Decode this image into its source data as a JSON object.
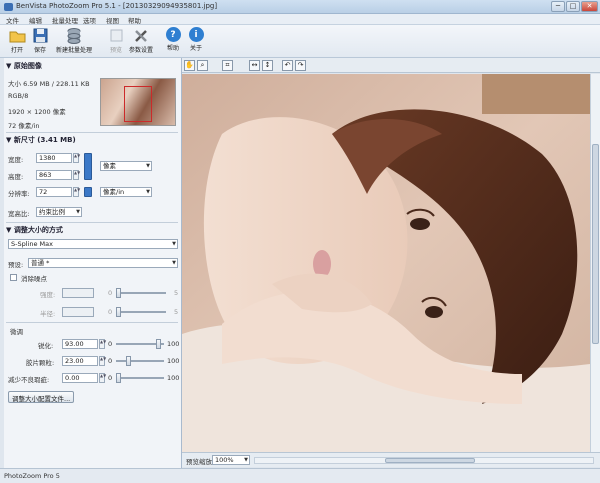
{
  "window": {
    "title": "BenVista PhotoZoom Pro 5.1 - [20130329094935801.jpg]",
    "min_label": "─",
    "max_label": "□",
    "close_label": "✕"
  },
  "menu": [
    "文件",
    "编辑",
    "批量处理",
    "选项",
    "视图",
    "帮助"
  ],
  "toolbar": {
    "open": "打开",
    "save": "保存",
    "batch": "新建批量处理",
    "preview": "预览",
    "settings": "参数设置",
    "help": "帮助",
    "about": "关于"
  },
  "original_image": {
    "header": "▼ 原始图像",
    "size_line": "大小 6.59 MB / 228.11 KB",
    "color_mode": "RGB/8",
    "dimensions": "1920 × 1200 像素",
    "resolution": "72 像素/in"
  },
  "new_size": {
    "header": "▼ 新尺寸 (3.41 MB)",
    "width_label": "宽度:",
    "width_value": "1380",
    "height_label": "高度:",
    "height_value": "863",
    "resolution_label": "分辨率:",
    "resolution_value": "72",
    "unit_select": "像素",
    "res_unit_select": "像素/in",
    "aspect_label": "宽高比:",
    "aspect_value": "约束比例"
  },
  "resize_method": {
    "header": "▼ 调整大小的方式",
    "method_value": "S-Spline Max",
    "preset_label": "预设:",
    "preset_value": "普通 *"
  },
  "noise": {
    "checkbox_label": "消除噪点",
    "strength_label": "强度:",
    "radius_label": "半径:",
    "slider_min": "0",
    "slider_max": "5"
  },
  "tuning": {
    "header": "微调",
    "sharpen_label": "锐化:",
    "sharpen_value": "93.00",
    "sharpen_level": 0.93,
    "film_grain_label": "胶片颗粒:",
    "film_grain_value": "23.00",
    "film_grain_level": 0.23,
    "artifact_label": "减少不良瑕疵:",
    "artifact_value": "0.00",
    "artifact_level": 0.0,
    "slider_min": "0",
    "slider_max": "100"
  },
  "profile_button": "调整大小配置文件...",
  "view": {
    "zoom_label": "预览缩放:",
    "zoom_value": "100%"
  },
  "status": {
    "text": "PhotoZoom Pro 5"
  }
}
